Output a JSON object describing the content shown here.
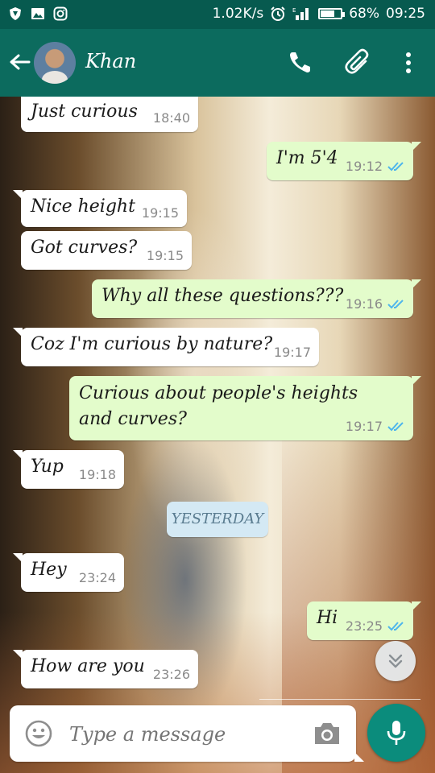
{
  "status_bar": {
    "speed": "1.02K/s",
    "battery_text": "68%",
    "battery_level": 0.68,
    "time": "09:25"
  },
  "header": {
    "contact_name": "Khan"
  },
  "messages": [
    {
      "direction": "in",
      "text": "Just curious",
      "time": "18:40"
    },
    {
      "direction": "out",
      "text": "I'm 5'4",
      "time": "19:12",
      "read": true
    },
    {
      "direction": "in",
      "text": "Nice height",
      "time": "19:15"
    },
    {
      "direction": "in",
      "text": "Got curves?",
      "time": "19:15"
    },
    {
      "direction": "out",
      "text": "Why all these questions???",
      "time": "19:16",
      "read": true
    },
    {
      "direction": "in",
      "text": "Coz I'm curious by nature?",
      "time": "19:17"
    },
    {
      "direction": "out",
      "text": "Curious about people's heights and curves?",
      "time": "19:17",
      "read": true
    },
    {
      "direction": "in",
      "text": "Yup",
      "time": "19:18"
    },
    {
      "direction": "in",
      "text": "Hey",
      "time": "23:24"
    },
    {
      "direction": "out",
      "text": "Hi",
      "time": "23:25",
      "read": true
    },
    {
      "direction": "in",
      "text": "How are you",
      "time": "23:26"
    }
  ],
  "date_chip": "YESTERDAY",
  "composer": {
    "placeholder": "Type a message"
  },
  "colors": {
    "header": "#0c6b5e",
    "status_bar": "#075a4f",
    "outgoing_bubble": "#e3fccb",
    "incoming_bubble": "#ffffff",
    "read_ticks": "#4fb6ec",
    "mic_button": "#0b8c7c"
  },
  "icons": [
    "back-arrow-icon",
    "call-icon",
    "attach-icon",
    "menu-icon",
    "emoji-icon",
    "camera-icon",
    "mic-icon",
    "chevron-double-down-icon"
  ]
}
